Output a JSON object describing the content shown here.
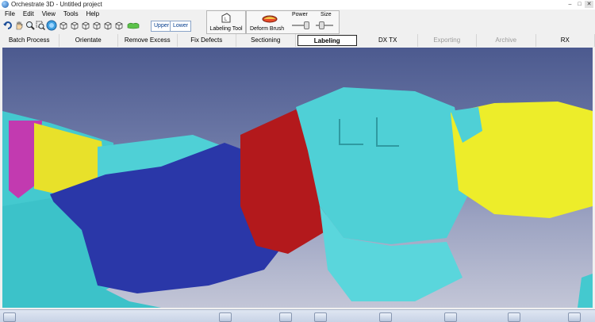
{
  "window": {
    "title": "Orchestrate 3D - Untitled project",
    "controls": [
      "–",
      "□",
      "✕"
    ]
  },
  "menu": [
    "File",
    "Edit",
    "View",
    "Tools",
    "Help"
  ],
  "toolbar": {
    "icons": [
      "undo-icon",
      "pan-hand-icon",
      "zoom-icon",
      "zoom-window-icon",
      "rotate-view-icon",
      "view-cube-front-icon",
      "view-cube-back-icon",
      "view-cube-left-icon",
      "view-cube-right-icon",
      "view-cube-top-icon",
      "view-cube-bottom-icon",
      "model-color-icon"
    ],
    "upper_label": "Upper",
    "lower_label": "Lower",
    "labeling_tool_label": "Labeling Tool",
    "deform_brush_label": "Deform Brush",
    "power_label": "Power",
    "size_label": "Size"
  },
  "tabs": [
    {
      "label": "Batch Process",
      "state": "normal"
    },
    {
      "label": "Orientate",
      "state": "normal"
    },
    {
      "label": "Remove Excess",
      "state": "normal"
    },
    {
      "label": "Fix Defects",
      "state": "normal"
    },
    {
      "label": "Sectioning",
      "state": "normal"
    },
    {
      "label": "Labeling",
      "state": "active"
    },
    {
      "label": "DX TX",
      "state": "normal"
    },
    {
      "label": "Exporting",
      "state": "disabled"
    },
    {
      "label": "Archive",
      "state": "disabled"
    },
    {
      "label": "RX",
      "state": "normal"
    }
  ],
  "colors": {
    "teal": "#4fd0d6",
    "navy": "#2a37a8",
    "yellow": "#eded2a",
    "red": "#b3191c",
    "magenta": "#c03aa9"
  }
}
